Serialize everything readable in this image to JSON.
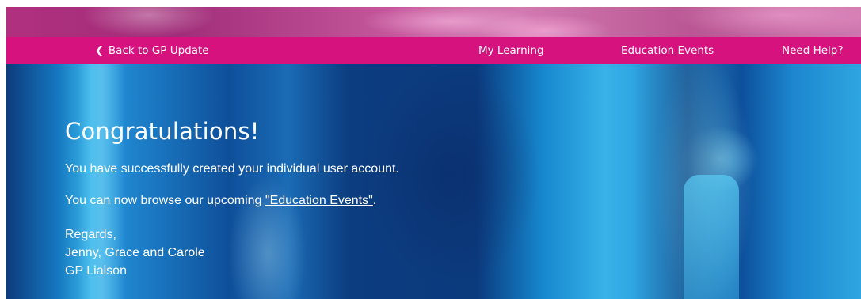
{
  "nav": {
    "back_label": "Back to GP Update",
    "my_learning": "My Learning",
    "education_events": "Education Events",
    "need_help": "Need Help?"
  },
  "main": {
    "title": "Congratulations!",
    "line1": "You have successfully created your individual user account.",
    "line2_prefix": "You can now browse our upcoming ",
    "line2_link": "\"Education Events\"",
    "line2_suffix": ".",
    "signature": {
      "greeting": "Regards,",
      "names": "Jenny, Grace and Carole",
      "team": "GP Liaison"
    }
  },
  "colors": {
    "nav_bg": "#d6127f",
    "hero_bg": "#0b3a7d",
    "text": "#ffffff"
  },
  "icons": {
    "back": "chevron-left-icon"
  }
}
